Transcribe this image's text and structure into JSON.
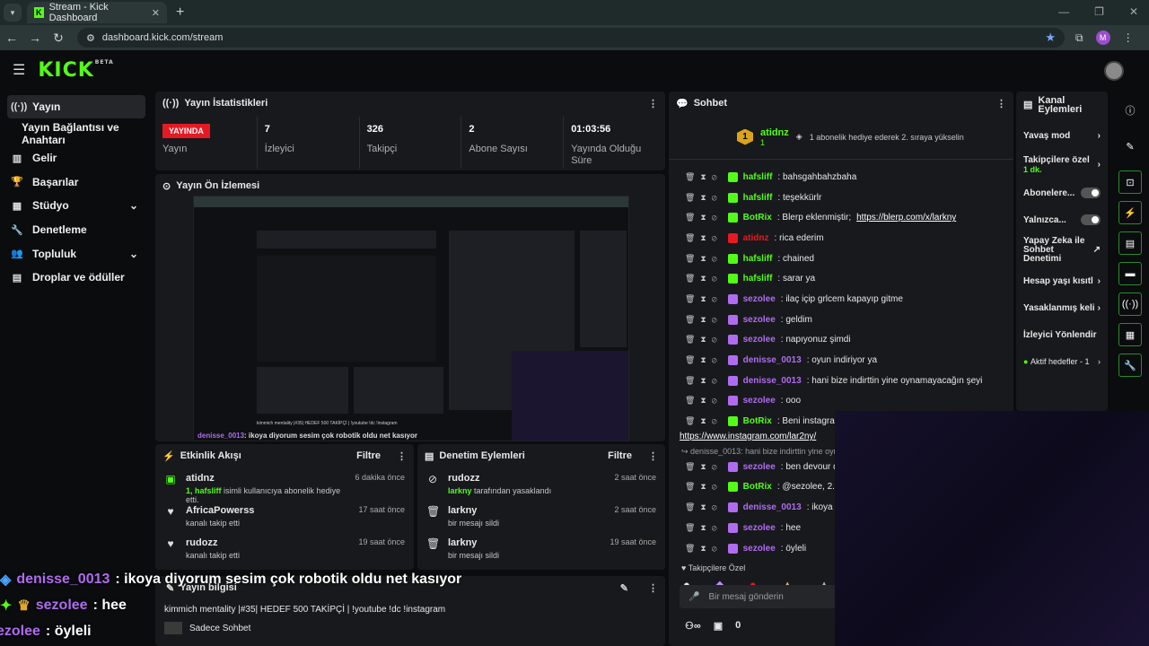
{
  "browser": {
    "tab_title": "Stream - Kick Dashboard",
    "url": "dashboard.kick.com/stream",
    "profile_initial": "M"
  },
  "sidebar": {
    "items": [
      {
        "label": "Yayın",
        "icon": "broadcast-icon"
      },
      {
        "label": "Yayın Bağlantısı ve Anahtarı"
      },
      {
        "label": "Gelir",
        "icon": "chart-icon"
      },
      {
        "label": "Başarılar",
        "icon": "trophy-icon"
      },
      {
        "label": "Stüdyo",
        "icon": "studio-icon"
      },
      {
        "label": "Denetleme",
        "icon": "wrench-icon"
      },
      {
        "label": "Topluluk",
        "icon": "people-icon"
      },
      {
        "label": "Droplar ve ödüller",
        "icon": "gift-icon"
      }
    ]
  },
  "stats": {
    "title": "Yayın İstatistikleri",
    "live_label": "YAYINDA",
    "items": [
      {
        "value": "",
        "label": "Yayın"
      },
      {
        "value": "7",
        "label": "İzleyici"
      },
      {
        "value": "326",
        "label": "Takipçi"
      },
      {
        "value": "2",
        "label": "Abone Sayısı"
      },
      {
        "value": "01:03:56",
        "label": "Yayında Olduğu Süre"
      }
    ]
  },
  "preview": {
    "title": "Yayın Ön İzlemesi",
    "caption_user": "denisse_0013",
    "caption_text": ": ikoya diyorum sesim çok robotik oldu net kasıyor",
    "info_line": "kimmich mentality |#35| HEDEF 500 TAKİPÇİ | !youtube !dc !instagram"
  },
  "events": {
    "title": "Etkinlik Akışı",
    "filter": "Filtre",
    "rows": [
      {
        "name": "atidnz",
        "detail_strong": "1, hafsliff",
        "detail": " isimli kullanıcıya abonelik hediye etti.",
        "time": "6 dakika önce"
      },
      {
        "name": "AfricaPowerss",
        "detail_strong": "",
        "detail": "kanalı takip etti",
        "time": "17 saat önce"
      },
      {
        "name": "rudozz",
        "detail_strong": "",
        "detail": "kanalı takip etti",
        "time": "19 saat önce"
      }
    ]
  },
  "mod": {
    "title": "Denetim Eylemleri",
    "filter": "Filtre",
    "rows": [
      {
        "name": "rudozz",
        "detail_strong": "larkny",
        "detail": " tarafından yasaklandı",
        "time": "2 saat önce"
      },
      {
        "name": "larkny",
        "detail_strong": "",
        "detail": "bir mesajı sildi",
        "time": "2 saat önce"
      },
      {
        "name": "larkny",
        "detail_strong": "",
        "detail": "bir mesajı sildi",
        "time": "19 saat önce"
      }
    ]
  },
  "info": {
    "title": "Yayın bilgisi",
    "text": "kimmich mentality |#35| HEDEF 500 TAKİPÇİ | !youtube !dc !instagram",
    "chat_mode": "Sadece Sohbet"
  },
  "chat": {
    "title": "Sohbet",
    "pinned_user": "atidnz",
    "pinned_count": "1",
    "pinned_note": "1 abonelik hediye ederek 2. sıraya yükselin",
    "messages": [
      {
        "user": "hafsliff",
        "color": "#53fc18",
        "text": ": bahsgahbahzbaha"
      },
      {
        "user": "hafsliff",
        "color": "#53fc18",
        "text": ": teşekkürlr"
      },
      {
        "user": "BotRix",
        "color": "#53fc18",
        "text": ": Blerp eklenmiştir; ",
        "link": "https://blerp.com/x/larkny"
      },
      {
        "user": "atidnz",
        "color": "#e51a23",
        "text": ": rica ederim"
      },
      {
        "user": "hafsliff",
        "color": "#53fc18",
        "text": ": chained"
      },
      {
        "user": "hafsliff",
        "color": "#53fc18",
        "text": ": sarar ya"
      },
      {
        "user": "sezolee",
        "color": "#b06cf0",
        "text": ": ilaç içip grlcem kapayıp gitme"
      },
      {
        "user": "sezolee",
        "color": "#b06cf0",
        "text": ": geldim"
      },
      {
        "user": "sezolee",
        "color": "#b06cf0",
        "text": ": napıyonuz şimdi"
      },
      {
        "user": "denisse_0013",
        "color": "#b06cf0",
        "text": ": oyun indiriyor ya"
      },
      {
        "user": "denisse_0013",
        "color": "#b06cf0",
        "text": ": hani bize indirttin yine oynamayacağın şeyi"
      },
      {
        "user": "sezolee",
        "color": "#b06cf0",
        "text": ": ooo"
      },
      {
        "user": "BotRix",
        "color": "#53fc18",
        "text": ": Beni instagram"
      }
    ],
    "link_line": "https://www.instagram.com/lar2ny/",
    "reply_line": "denisse_0013: hani bize indirttin yine oyna",
    "messages2": [
      {
        "user": "sezolee",
        "color": "#b06cf0",
        "text": ": ben devour d"
      },
      {
        "user": "BotRix",
        "color": "#53fc18",
        "text": ": @sezolee, 2. s"
      },
      {
        "user": "denisse_0013",
        "color": "#b06cf0",
        "text": ": ikoya diyor"
      },
      {
        "user": "sezolee",
        "color": "#b06cf0",
        "text": ": hee"
      },
      {
        "user": "sezolee",
        "color": "#b06cf0",
        "text": ": öyleli"
      }
    ],
    "followers_only": "Takipçilere Özel",
    "input_placeholder": "Bir mesaj gönderin",
    "bottom_count": "0"
  },
  "actions": {
    "title": "Kanal Eylemleri",
    "items": [
      {
        "label": "Yavaş mod",
        "sub": ""
      },
      {
        "label": "Takipçilere özel",
        "sub": "1 dk."
      },
      {
        "label": "Abonelere...",
        "sub": ""
      },
      {
        "label": "Yalnızca...",
        "sub": ""
      },
      {
        "label": "Yapay Zeka ile Sohbet Denetimi",
        "sub": ""
      },
      {
        "label": "Hesap yaşı kısıtl",
        "sub": ""
      },
      {
        "label": "Yasaklanmış keli",
        "sub": ""
      },
      {
        "label": "İzleyici Yönlendir",
        "sub": ""
      },
      {
        "label": "Aktif hedefler - 1",
        "sub": ""
      }
    ]
  },
  "overlay": {
    "lines": [
      {
        "user": "denisse_0013",
        "text": ": ikoya diyorum sesim çok robotik oldu net kasıyor"
      },
      {
        "user": "sezolee",
        "text": ": hee"
      },
      {
        "user": "ezolee",
        "text": ": öyleli"
      }
    ]
  },
  "colors": {
    "accent": "#53fc18",
    "live": "#e51a23",
    "sub": "#b06cf0"
  }
}
